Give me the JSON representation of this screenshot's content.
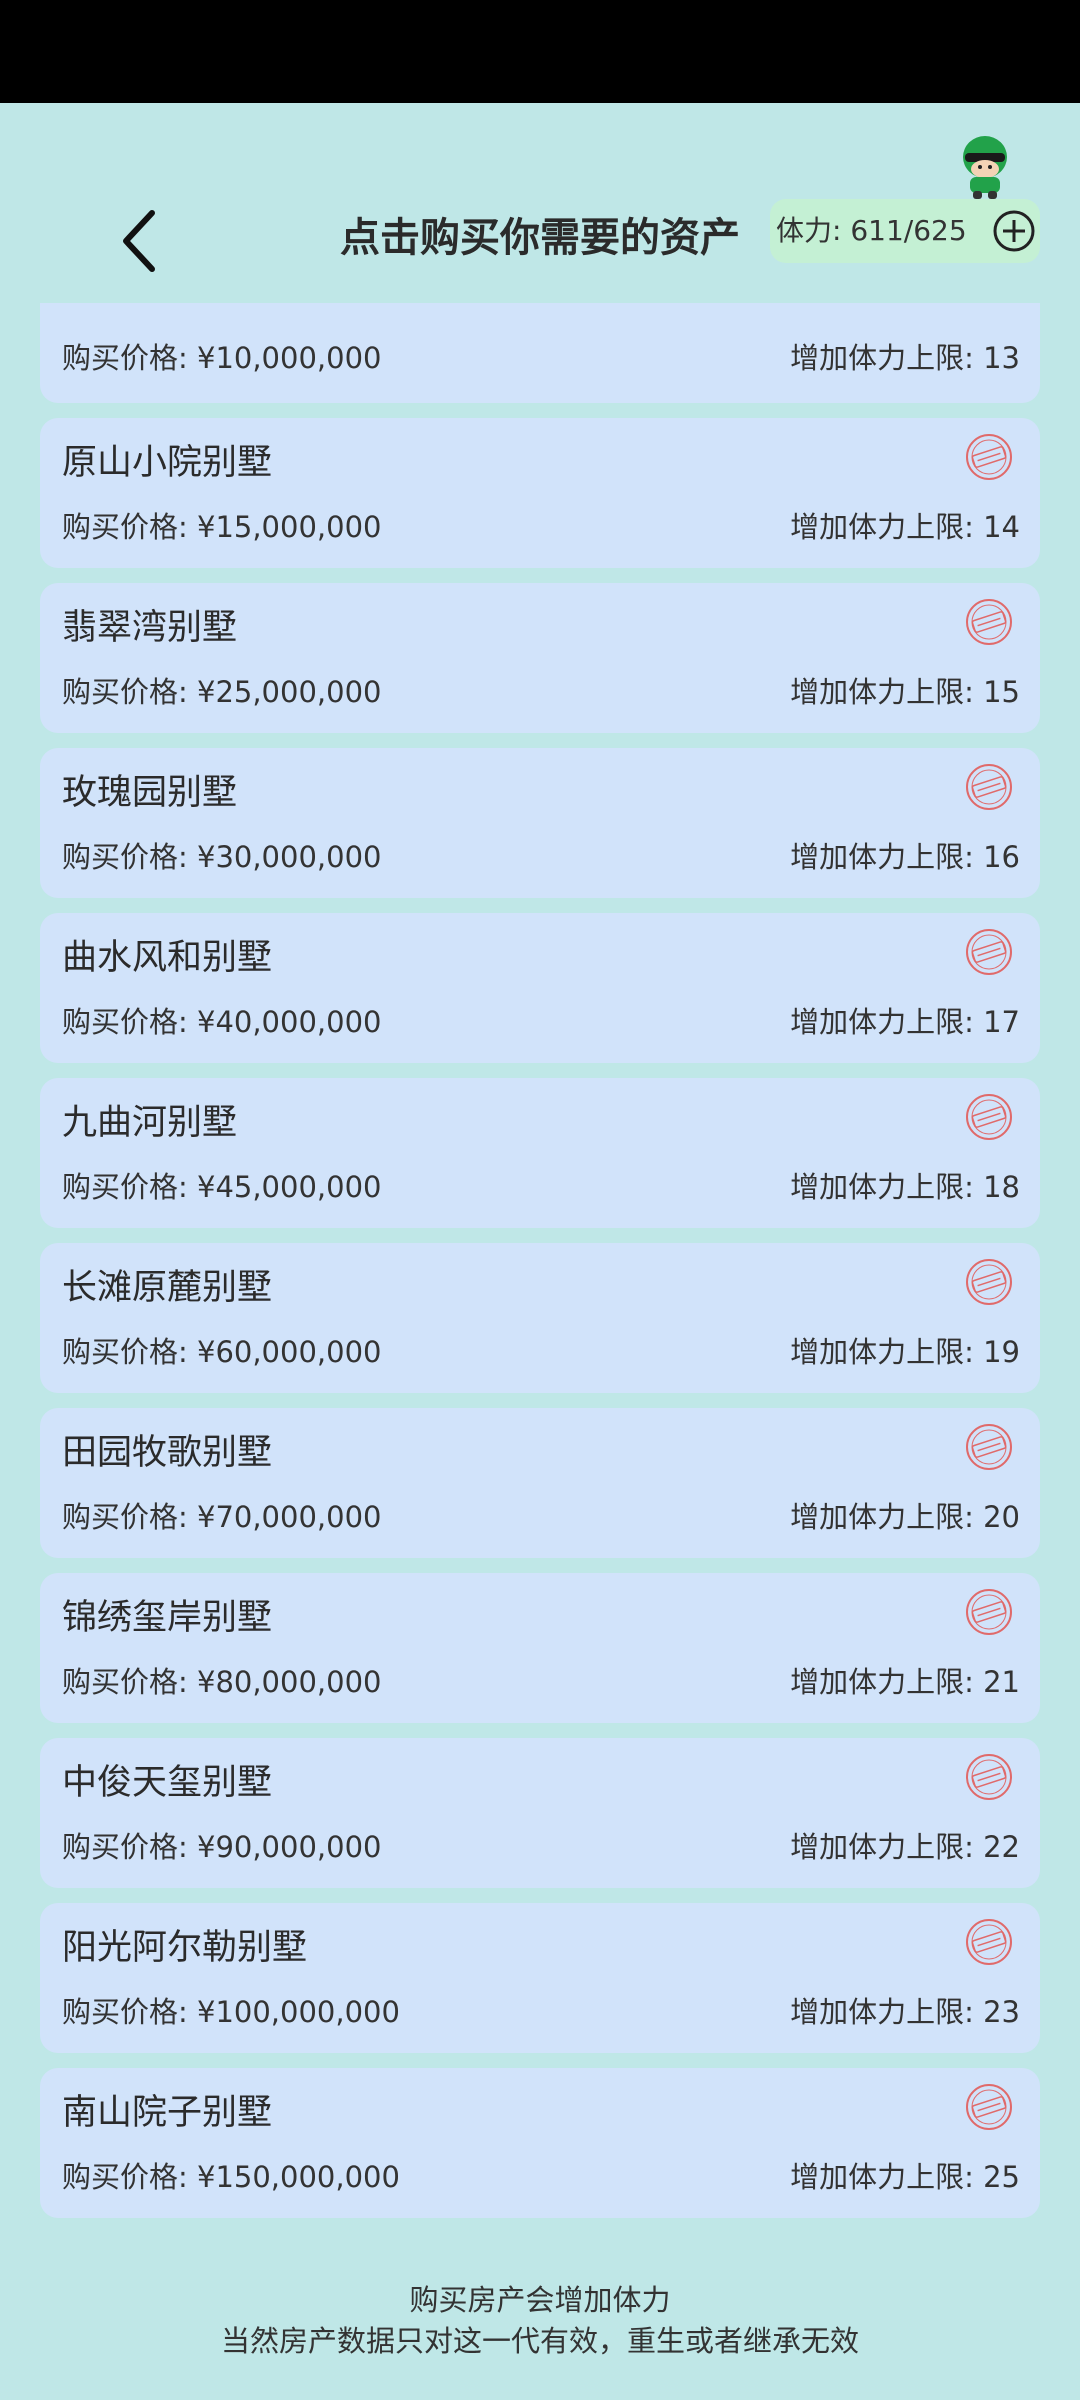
{
  "header": {
    "title": "点击购买你需要的资产",
    "stamina": "体力: 611/625"
  },
  "assets": [
    {
      "name": "",
      "price": "购买价格: ¥10,000,000",
      "bonus": "增加体力上限: 13",
      "owned": true
    },
    {
      "name": "原山小院别墅",
      "price": "购买价格: ¥15,000,000",
      "bonus": "增加体力上限: 14",
      "owned": true
    },
    {
      "name": "翡翠湾别墅",
      "price": "购买价格: ¥25,000,000",
      "bonus": "增加体力上限: 15",
      "owned": true
    },
    {
      "name": "玫瑰园别墅",
      "price": "购买价格: ¥30,000,000",
      "bonus": "增加体力上限: 16",
      "owned": true
    },
    {
      "name": "曲水风和别墅",
      "price": "购买价格: ¥40,000,000",
      "bonus": "增加体力上限: 17",
      "owned": true
    },
    {
      "name": "九曲河别墅",
      "price": "购买价格: ¥45,000,000",
      "bonus": "增加体力上限: 18",
      "owned": true
    },
    {
      "name": "长滩原麓别墅",
      "price": "购买价格: ¥60,000,000",
      "bonus": "增加体力上限: 19",
      "owned": true
    },
    {
      "name": "田园牧歌别墅",
      "price": "购买价格: ¥70,000,000",
      "bonus": "增加体力上限: 20",
      "owned": true
    },
    {
      "name": "锦绣玺岸别墅",
      "price": "购买价格: ¥80,000,000",
      "bonus": "增加体力上限: 21",
      "owned": true
    },
    {
      "name": "中俊天玺别墅",
      "price": "购买价格: ¥90,000,000",
      "bonus": "增加体力上限: 22",
      "owned": true
    },
    {
      "name": "阳光阿尔勒别墅",
      "price": "购买价格: ¥100,000,000",
      "bonus": "增加体力上限: 23",
      "owned": true
    },
    {
      "name": "南山院子别墅",
      "price": "购买价格: ¥150,000,000",
      "bonus": "增加体力上限: 25",
      "owned": true
    }
  ],
  "footer": {
    "line1": "购买房产会增加体力",
    "line2": "当然房产数据只对这一代有效，重生或者继承无效"
  },
  "colors": {
    "background": "#bfe7e7",
    "card": "#d1e3fa",
    "stamina_badge": "#c4f0d4",
    "stamp": "#e06a6a"
  },
  "icons": {
    "back": "chevron-left-icon",
    "add": "plus-circle-icon",
    "owned_stamp": "owned-stamp-icon",
    "mascot": "mascot-icon"
  }
}
